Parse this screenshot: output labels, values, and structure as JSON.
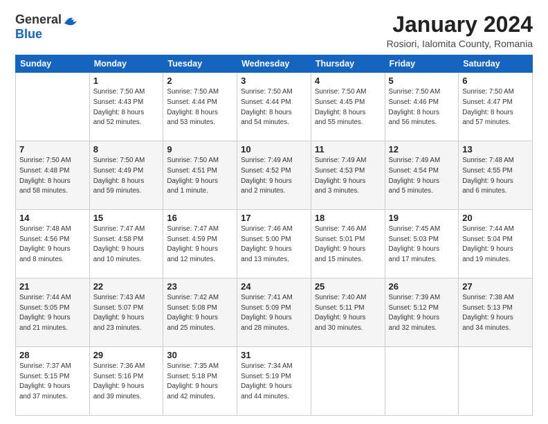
{
  "logo": {
    "general": "General",
    "blue": "Blue"
  },
  "title": "January 2024",
  "subtitle": "Rosiori, Ialomita County, Romania",
  "weekdays": [
    "Sunday",
    "Monday",
    "Tuesday",
    "Wednesday",
    "Thursday",
    "Friday",
    "Saturday"
  ],
  "weeks": [
    [
      {
        "day": "",
        "sunrise": "",
        "sunset": "",
        "daylight": ""
      },
      {
        "day": "1",
        "sunrise": "Sunrise: 7:50 AM",
        "sunset": "Sunset: 4:43 PM",
        "daylight": "Daylight: 8 hours and 52 minutes."
      },
      {
        "day": "2",
        "sunrise": "Sunrise: 7:50 AM",
        "sunset": "Sunset: 4:44 PM",
        "daylight": "Daylight: 8 hours and 53 minutes."
      },
      {
        "day": "3",
        "sunrise": "Sunrise: 7:50 AM",
        "sunset": "Sunset: 4:44 PM",
        "daylight": "Daylight: 8 hours and 54 minutes."
      },
      {
        "day": "4",
        "sunrise": "Sunrise: 7:50 AM",
        "sunset": "Sunset: 4:45 PM",
        "daylight": "Daylight: 8 hours and 55 minutes."
      },
      {
        "day": "5",
        "sunrise": "Sunrise: 7:50 AM",
        "sunset": "Sunset: 4:46 PM",
        "daylight": "Daylight: 8 hours and 56 minutes."
      },
      {
        "day": "6",
        "sunrise": "Sunrise: 7:50 AM",
        "sunset": "Sunset: 4:47 PM",
        "daylight": "Daylight: 8 hours and 57 minutes."
      }
    ],
    [
      {
        "day": "7",
        "sunrise": "Sunrise: 7:50 AM",
        "sunset": "Sunset: 4:48 PM",
        "daylight": "Daylight: 8 hours and 58 minutes."
      },
      {
        "day": "8",
        "sunrise": "Sunrise: 7:50 AM",
        "sunset": "Sunset: 4:49 PM",
        "daylight": "Daylight: 8 hours and 59 minutes."
      },
      {
        "day": "9",
        "sunrise": "Sunrise: 7:50 AM",
        "sunset": "Sunset: 4:51 PM",
        "daylight": "Daylight: 9 hours and 1 minute."
      },
      {
        "day": "10",
        "sunrise": "Sunrise: 7:49 AM",
        "sunset": "Sunset: 4:52 PM",
        "daylight": "Daylight: 9 hours and 2 minutes."
      },
      {
        "day": "11",
        "sunrise": "Sunrise: 7:49 AM",
        "sunset": "Sunset: 4:53 PM",
        "daylight": "Daylight: 9 hours and 3 minutes."
      },
      {
        "day": "12",
        "sunrise": "Sunrise: 7:49 AM",
        "sunset": "Sunset: 4:54 PM",
        "daylight": "Daylight: 9 hours and 5 minutes."
      },
      {
        "day": "13",
        "sunrise": "Sunrise: 7:48 AM",
        "sunset": "Sunset: 4:55 PM",
        "daylight": "Daylight: 9 hours and 6 minutes."
      }
    ],
    [
      {
        "day": "14",
        "sunrise": "Sunrise: 7:48 AM",
        "sunset": "Sunset: 4:56 PM",
        "daylight": "Daylight: 9 hours and 8 minutes."
      },
      {
        "day": "15",
        "sunrise": "Sunrise: 7:47 AM",
        "sunset": "Sunset: 4:58 PM",
        "daylight": "Daylight: 9 hours and 10 minutes."
      },
      {
        "day": "16",
        "sunrise": "Sunrise: 7:47 AM",
        "sunset": "Sunset: 4:59 PM",
        "daylight": "Daylight: 9 hours and 12 minutes."
      },
      {
        "day": "17",
        "sunrise": "Sunrise: 7:46 AM",
        "sunset": "Sunset: 5:00 PM",
        "daylight": "Daylight: 9 hours and 13 minutes."
      },
      {
        "day": "18",
        "sunrise": "Sunrise: 7:46 AM",
        "sunset": "Sunset: 5:01 PM",
        "daylight": "Daylight: 9 hours and 15 minutes."
      },
      {
        "day": "19",
        "sunrise": "Sunrise: 7:45 AM",
        "sunset": "Sunset: 5:03 PM",
        "daylight": "Daylight: 9 hours and 17 minutes."
      },
      {
        "day": "20",
        "sunrise": "Sunrise: 7:44 AM",
        "sunset": "Sunset: 5:04 PM",
        "daylight": "Daylight: 9 hours and 19 minutes."
      }
    ],
    [
      {
        "day": "21",
        "sunrise": "Sunrise: 7:44 AM",
        "sunset": "Sunset: 5:05 PM",
        "daylight": "Daylight: 9 hours and 21 minutes."
      },
      {
        "day": "22",
        "sunrise": "Sunrise: 7:43 AM",
        "sunset": "Sunset: 5:07 PM",
        "daylight": "Daylight: 9 hours and 23 minutes."
      },
      {
        "day": "23",
        "sunrise": "Sunrise: 7:42 AM",
        "sunset": "Sunset: 5:08 PM",
        "daylight": "Daylight: 9 hours and 25 minutes."
      },
      {
        "day": "24",
        "sunrise": "Sunrise: 7:41 AM",
        "sunset": "Sunset: 5:09 PM",
        "daylight": "Daylight: 9 hours and 28 minutes."
      },
      {
        "day": "25",
        "sunrise": "Sunrise: 7:40 AM",
        "sunset": "Sunset: 5:11 PM",
        "daylight": "Daylight: 9 hours and 30 minutes."
      },
      {
        "day": "26",
        "sunrise": "Sunrise: 7:39 AM",
        "sunset": "Sunset: 5:12 PM",
        "daylight": "Daylight: 9 hours and 32 minutes."
      },
      {
        "day": "27",
        "sunrise": "Sunrise: 7:38 AM",
        "sunset": "Sunset: 5:13 PM",
        "daylight": "Daylight: 9 hours and 34 minutes."
      }
    ],
    [
      {
        "day": "28",
        "sunrise": "Sunrise: 7:37 AM",
        "sunset": "Sunset: 5:15 PM",
        "daylight": "Daylight: 9 hours and 37 minutes."
      },
      {
        "day": "29",
        "sunrise": "Sunrise: 7:36 AM",
        "sunset": "Sunset: 5:16 PM",
        "daylight": "Daylight: 9 hours and 39 minutes."
      },
      {
        "day": "30",
        "sunrise": "Sunrise: 7:35 AM",
        "sunset": "Sunset: 5:18 PM",
        "daylight": "Daylight: 9 hours and 42 minutes."
      },
      {
        "day": "31",
        "sunrise": "Sunrise: 7:34 AM",
        "sunset": "Sunset: 5:19 PM",
        "daylight": "Daylight: 9 hours and 44 minutes."
      },
      {
        "day": "",
        "sunrise": "",
        "sunset": "",
        "daylight": ""
      },
      {
        "day": "",
        "sunrise": "",
        "sunset": "",
        "daylight": ""
      },
      {
        "day": "",
        "sunrise": "",
        "sunset": "",
        "daylight": ""
      }
    ]
  ]
}
